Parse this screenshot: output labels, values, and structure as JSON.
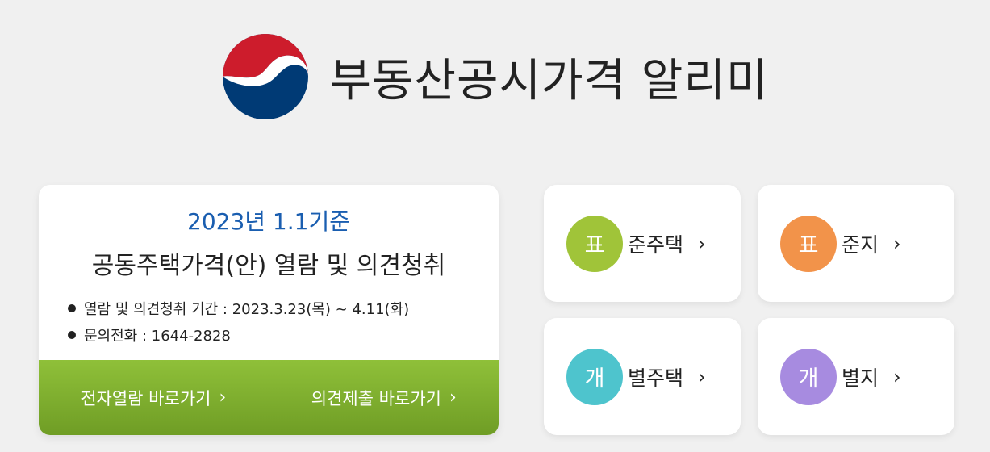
{
  "header": {
    "title": "부동산공시가격 알리미",
    "logo_icon": "korea-government-taegeuk-emblem",
    "logo_colors": {
      "red": "#cd1c2c",
      "navy": "#003a75"
    }
  },
  "notice": {
    "date_label": "2023년 1.1기준",
    "title": "공동주택가격(안) 열람 및 의견청취",
    "info": [
      "열람 및 의견청취 기간 : 2023.3.23(목) ~ 4.11(화)",
      "문의전화 : 1644-2828"
    ],
    "buttons": [
      {
        "label": "전자열람 바로가기",
        "chevron": "›"
      },
      {
        "label": "의견제출 바로가기",
        "chevron": "›"
      }
    ],
    "accent_color": "#1a5eb0",
    "button_color": "#7fab2c"
  },
  "tiles": [
    {
      "circle_text": "표",
      "label": "준주택",
      "chevron": "›",
      "color": "#a0c439"
    },
    {
      "circle_text": "표",
      "label": "준지",
      "chevron": "›",
      "color": "#f2934a"
    },
    {
      "circle_text": "개",
      "label": "별주택",
      "chevron": "›",
      "color": "#4ec4cd"
    },
    {
      "circle_text": "개",
      "label": "별지",
      "chevron": "›",
      "color": "#a78be0"
    }
  ]
}
